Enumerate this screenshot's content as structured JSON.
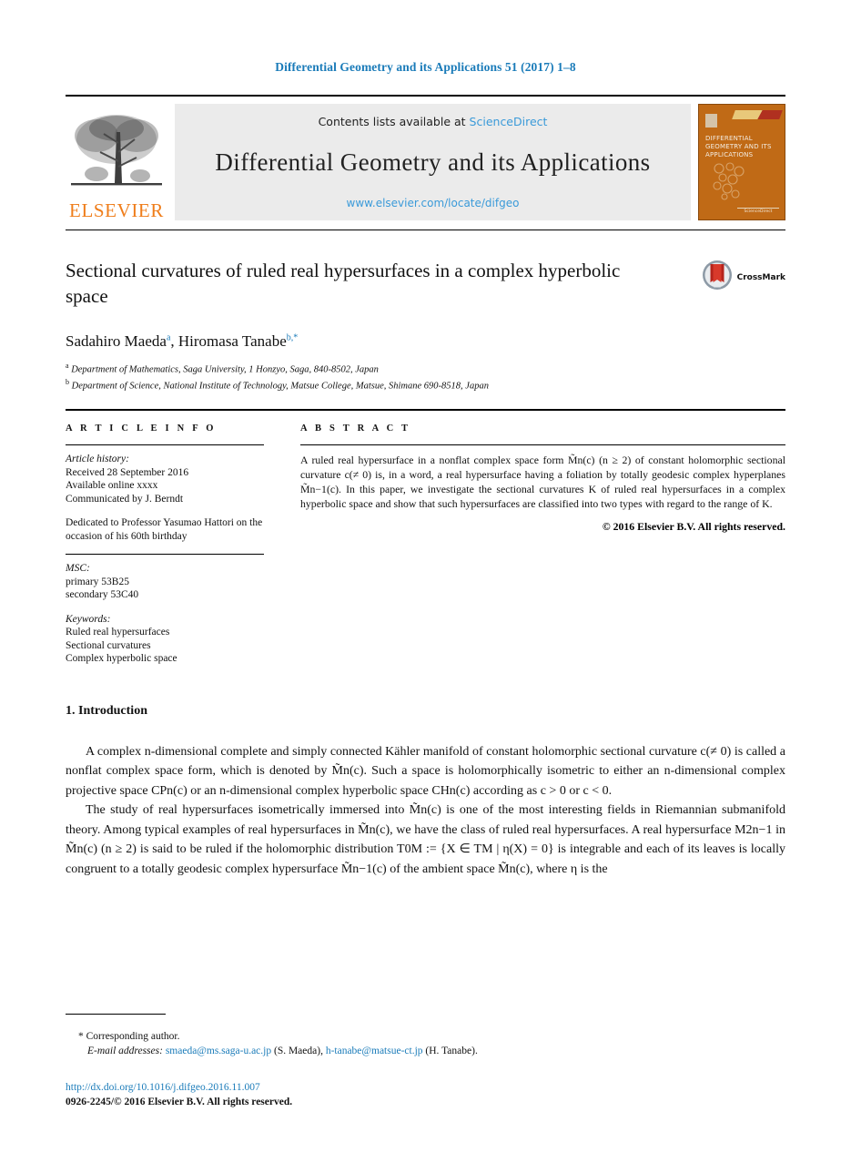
{
  "running_head": "Differential Geometry and its Applications 51 (2017) 1–8",
  "masthead": {
    "publisher_name": "ELSEVIER",
    "contents_prefix": "Contents lists available at ",
    "contents_link": "ScienceDirect",
    "journal_title": "Differential Geometry and its Applications",
    "journal_url": "www.elsevier.com/locate/difgeo",
    "cover": {
      "title": "DIFFERENTIAL GEOMETRY AND ITS APPLICATIONS",
      "footer": "ScienceDirect",
      "color": "#c06a16"
    }
  },
  "article": {
    "title": "Sectional curvatures of ruled real hypersurfaces in a complex hyperbolic space",
    "crossmark_label": "CrossMark",
    "authors": "Sadahiro Maeda a, Hiromasa Tanabe b,*",
    "author_list": [
      {
        "name": "Sadahiro Maeda",
        "marker": "a"
      },
      {
        "name": "Hiromasa Tanabe",
        "marker": "b,*"
      }
    ],
    "affiliations": [
      {
        "marker": "a",
        "text": "Department of Mathematics, Saga University, 1 Honzyo, Saga, 840-8502, Japan"
      },
      {
        "marker": "b",
        "text": "Department of Science, National Institute of Technology, Matsue College, Matsue, Shimane 690-8518, Japan"
      }
    ]
  },
  "info": {
    "heading": "A R T I C L E    I N F O",
    "history_label": "Article history:",
    "history": [
      "Received 28 September 2016",
      "Available online xxxx",
      "Communicated by J. Berndt"
    ],
    "dedication": "Dedicated to Professor Yasumao Hattori on the occasion of his 60th birthday",
    "msc_label": "MSC:",
    "msc": [
      "primary 53B25",
      "secondary 53C40"
    ],
    "keywords_label": "Keywords:",
    "keywords": [
      "Ruled real hypersurfaces",
      "Sectional curvatures",
      "Complex hyperbolic space"
    ]
  },
  "abstract": {
    "heading": "A B S T R A C T",
    "text": "A ruled real hypersurface in a nonflat complex space form M̃n(c) (n ≥ 2) of constant holomorphic sectional curvature c(≠ 0) is, in a word, a real hypersurface having a foliation by totally geodesic complex hyperplanes M̃n−1(c). In this paper, we investigate the sectional curvatures K of ruled real hypersurfaces in a complex hyperbolic space and show that such hypersurfaces are classified into two types with regard to the range of K.",
    "copyright": "© 2016 Elsevier B.V. All rights reserved."
  },
  "body": {
    "section_number": "1.",
    "section_title": "Introduction",
    "paragraph1": "A complex n-dimensional complete and simply connected Kähler manifold of constant holomorphic sectional curvature c(≠ 0) is called a nonflat complex space form, which is denoted by M̃n(c). Such a space is holomorphically isometric to either an n-dimensional complex projective space CPn(c) or an n-dimensional complex hyperbolic space CHn(c) according as c > 0 or c < 0.",
    "paragraph2": "The study of real hypersurfaces isometrically immersed into M̃n(c) is one of the most interesting fields in Riemannian submanifold theory. Among typical examples of real hypersurfaces in M̃n(c), we have the class of ruled real hypersurfaces. A real hypersurface M2n−1 in M̃n(c) (n ≥ 2) is said to be ruled if the holomorphic distribution T0M := {X ∈ TM | η(X) = 0} is integrable and each of its leaves is locally congruent to a totally geodesic complex hypersurface M̃n−1(c) of the ambient space M̃n(c), where η is the"
  },
  "footer": {
    "corresponding_marker": "*",
    "corresponding_text": "Corresponding author.",
    "email_label": "E-mail addresses:",
    "email1": "smaeda@ms.saga-u.ac.jp",
    "email1_who": "(S. Maeda),",
    "email2": "h-tanabe@matsue-ct.jp",
    "email2_who": "(H. Tanabe).",
    "doi": "http://dx.doi.org/10.1016/j.difgeo.2016.11.007",
    "issn_line": "0926-2245/© 2016 Elsevier B.V. All rights reserved."
  },
  "colors": {
    "link": "#1a7bb9",
    "banner_bg": "#ebebeb",
    "elsevier_orange": "#ef7d1a",
    "cover_orange": "#c06a16"
  }
}
